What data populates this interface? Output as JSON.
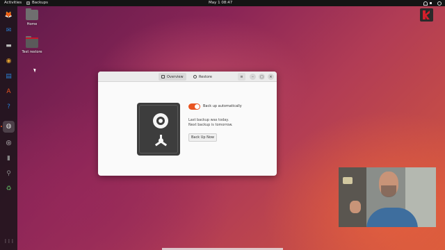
{
  "topbar": {
    "activities": "Activities",
    "app_name": "Backups",
    "clock": "May 1  08:47"
  },
  "dock": {
    "items": [
      {
        "icon": "firefox-icon",
        "glyph": "🦊",
        "color": "#e66000"
      },
      {
        "icon": "thunderbird-icon",
        "glyph": "✉",
        "color": "#2a7fd4"
      },
      {
        "icon": "files-icon",
        "glyph": "▬",
        "color": "#b9b9b9"
      },
      {
        "icon": "rhythmbox-icon",
        "glyph": "◉",
        "color": "#e0a030"
      },
      {
        "icon": "writer-icon",
        "glyph": "▤",
        "color": "#2a7fd4"
      },
      {
        "icon": "software-icon",
        "glyph": "A",
        "color": "#e95420"
      },
      {
        "icon": "help-icon",
        "glyph": "?",
        "color": "#2a7fd4"
      },
      {
        "icon": "backups-icon",
        "glyph": "◍",
        "color": "#444444"
      },
      {
        "icon": "disc-icon",
        "glyph": "◎",
        "color": "#dddddd"
      },
      {
        "icon": "drive-icon",
        "glyph": "▮",
        "color": "#777777"
      },
      {
        "icon": "usb-icon",
        "glyph": "⚲",
        "color": "#777777"
      },
      {
        "icon": "trash-icon",
        "glyph": "♻",
        "color": "#58a058"
      }
    ],
    "apps_grid_glyph": "⋮⋮⋮"
  },
  "desktop": {
    "icons": [
      {
        "label": "Home"
      },
      {
        "label": "Test restore"
      }
    ]
  },
  "window": {
    "tabs": [
      {
        "label": "Overview"
      },
      {
        "label": "Restore"
      }
    ],
    "menu_glyph": "≡",
    "minimize_glyph": "–",
    "maximize_glyph": "□",
    "close_glyph": "×",
    "toggle_label": "Back up automatically",
    "toggle_on": true,
    "status_line1": "Last backup was today.",
    "status_line2": "Next backup is tomorrow.",
    "backup_button": "Back Up Now"
  },
  "colors": {
    "accent": "#e95420"
  }
}
